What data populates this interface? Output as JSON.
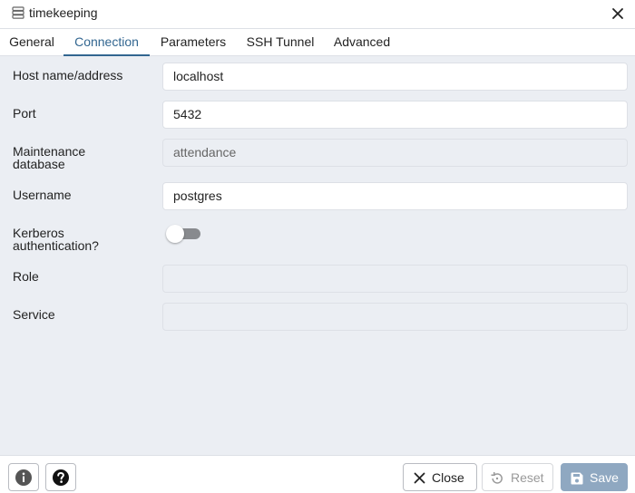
{
  "window": {
    "title": "timekeeping",
    "close_icon": "close-icon"
  },
  "tabs": [
    {
      "label": "General"
    },
    {
      "label": "Connection"
    },
    {
      "label": "Parameters"
    },
    {
      "label": "SSH Tunnel"
    },
    {
      "label": "Advanced"
    }
  ],
  "active_tab": "Connection",
  "form": {
    "host": {
      "label": "Host name/address",
      "value": "localhost"
    },
    "port": {
      "label": "Port",
      "value": "5432"
    },
    "maintenance_db": {
      "label_line1": "Maintenance",
      "label_line2": "database",
      "value": "attendance"
    },
    "username": {
      "label": "Username",
      "value": "postgres"
    },
    "kerberos": {
      "label_line1": "Kerberos",
      "label_line2": "authentication?",
      "enabled": false
    },
    "role": {
      "label": "Role",
      "value": ""
    },
    "service": {
      "label": "Service",
      "value": ""
    }
  },
  "footer": {
    "info_icon": "info-icon",
    "help_icon": "help-icon",
    "close_label": "Close",
    "reset_label": "Reset",
    "save_label": "Save"
  },
  "colors": {
    "accent": "#326690",
    "content_bg": "#ebeef3",
    "save_disabled_bg": "#8fa8c1",
    "toggle_off": "#888a8e"
  }
}
